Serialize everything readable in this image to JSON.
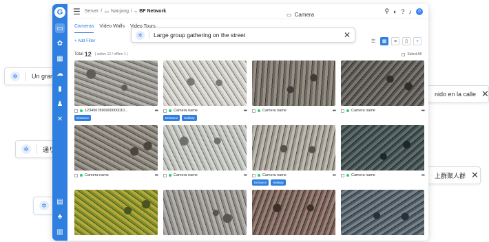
{
  "floating_chips": [
    {
      "text": "Un gran gru",
      "lang": "es"
    },
    {
      "text": "nido en la calle",
      "lang": "es"
    },
    {
      "text": "通りに",
      "lang": "ja"
    },
    {
      "text": "上群聚人群",
      "lang": "zh"
    },
    {
      "text": "",
      "lang": ""
    }
  ],
  "topbar": {
    "crumbs": [
      "Server",
      "Nanjang",
      "BF Network"
    ],
    "window_title": "Camera"
  },
  "tabs": [
    "Cameras",
    "Video Walls",
    "Video Tours"
  ],
  "toolbar": {
    "add_filter": "+ Add Filter"
  },
  "search": {
    "value": "Large group gathering on the street"
  },
  "summary": {
    "total_label": "Total",
    "total": "12",
    "sub": "( online 12 / offline 1 )",
    "select_all": "Select All"
  },
  "notification_count": "0",
  "cameras": [
    {
      "name": "1234567890000000010...",
      "tags": [
        "Entrance"
      ]
    },
    {
      "name": "Camera name",
      "tags": [
        "Entrance",
        "Hallway"
      ]
    },
    {
      "name": "Camera name",
      "tags": []
    },
    {
      "name": "Camera name",
      "tags": []
    },
    {
      "name": "Camera name",
      "tags": []
    },
    {
      "name": "Camera name",
      "tags": []
    },
    {
      "name": "Camera name",
      "tags": [
        "Entrance",
        "Hallway"
      ]
    },
    {
      "name": "Camera name",
      "tags": []
    },
    {
      "name": "",
      "tags": []
    },
    {
      "name": "",
      "tags": []
    },
    {
      "name": "",
      "tags": []
    },
    {
      "name": "",
      "tags": []
    }
  ],
  "colors": {
    "accent": "#2f7fe0",
    "online": "#2ecc71"
  }
}
